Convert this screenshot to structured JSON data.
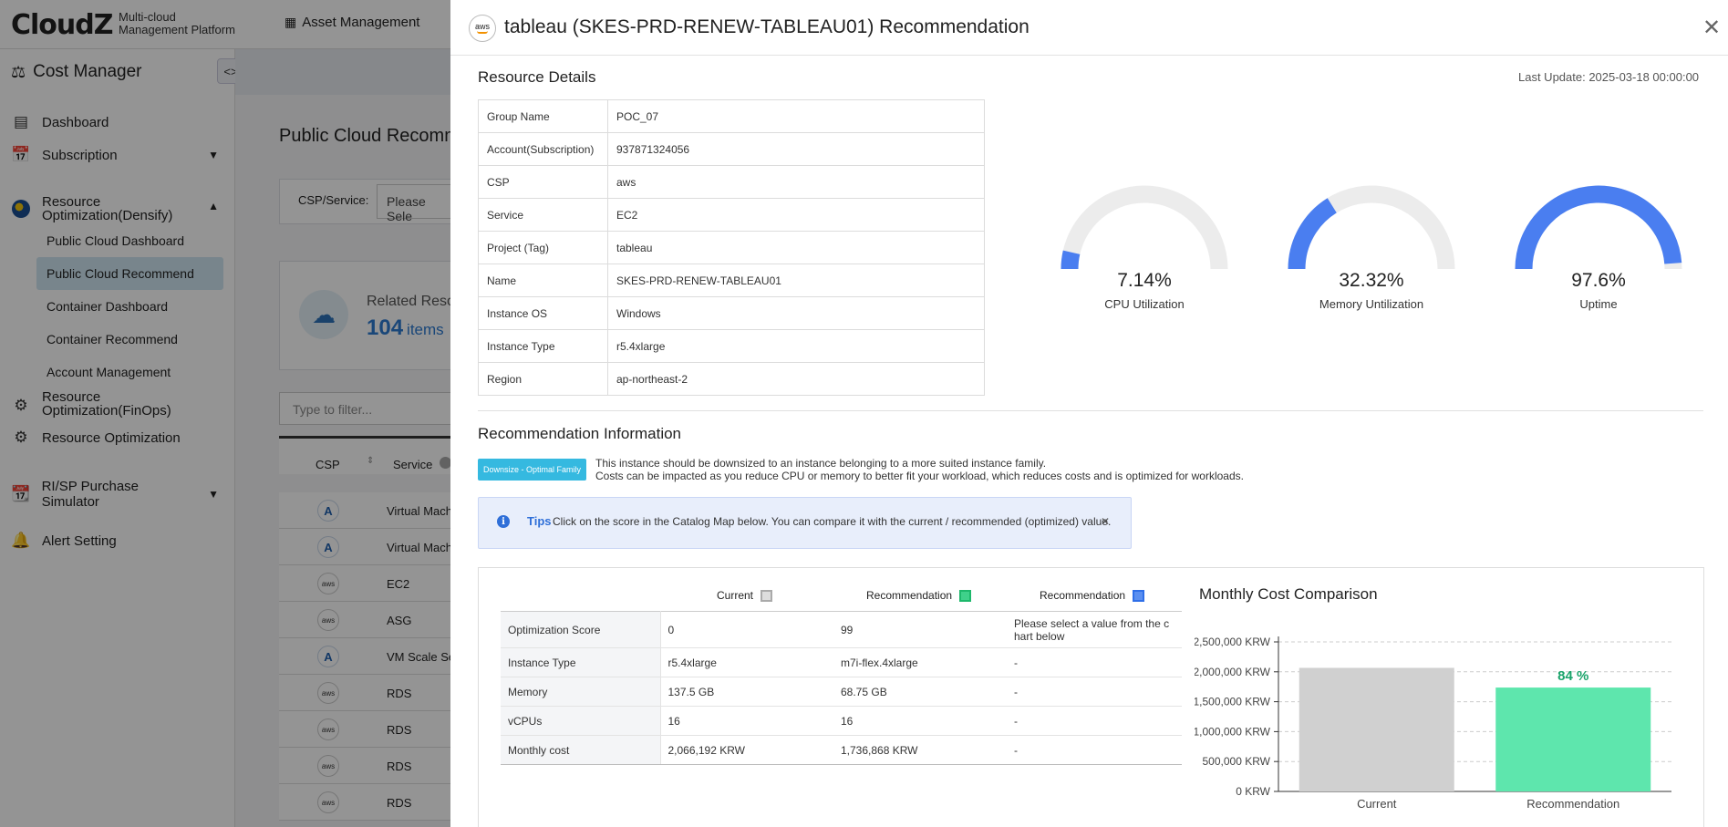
{
  "app": {
    "logo": "CloudZ",
    "logo_sub": "Multi-cloud\nManagement Platform",
    "top_nav": "Asset Management",
    "module_title": "Cost Manager",
    "toggle_icon": "code-brackets-icon"
  },
  "sidebar": {
    "items": [
      {
        "label": "Dashboard",
        "icon": "dashboard-grid-icon"
      },
      {
        "label": "Subscription",
        "icon": "calendar-icon"
      },
      {
        "label": "Resource Optimization(Densify)",
        "icon": "densify-logo-icon"
      },
      {
        "label": "Resource Optimization(FinOps)",
        "icon": "finops-gear-icon"
      },
      {
        "label": "Resource Optimization",
        "icon": "settings-gear-icon"
      },
      {
        "label": "RI/SP Purchase Simulator",
        "icon": "calendar-dollar-icon"
      },
      {
        "label": "Alert Setting",
        "icon": "bell-icon"
      }
    ],
    "sub_items": [
      {
        "label": "Public Cloud Dashboard",
        "active": false
      },
      {
        "label": "Public Cloud Recommend",
        "active": true
      },
      {
        "label": "Container Dashboard",
        "active": false
      },
      {
        "label": "Container Recommend",
        "active": false
      },
      {
        "label": "Account Management",
        "active": false
      }
    ]
  },
  "background_page": {
    "title": "Public Cloud Recomm",
    "csp_label": "CSP/Service:",
    "csp_select": "Please Sele",
    "related_label": "Related Reso",
    "related_count": "104",
    "related_unit": "items",
    "filter_placeholder": "Type to filter...",
    "columns": [
      "CSP",
      "Service"
    ],
    "rows": [
      {
        "csp": "azure",
        "service": "Virtual Machi"
      },
      {
        "csp": "azure",
        "service": "Virtual Machi"
      },
      {
        "csp": "aws",
        "service": "EC2"
      },
      {
        "csp": "aws",
        "service": "ASG"
      },
      {
        "csp": "azure",
        "service": "VM Scale Set"
      },
      {
        "csp": "aws",
        "service": "RDS"
      },
      {
        "csp": "aws",
        "service": "RDS"
      },
      {
        "csp": "aws",
        "service": "RDS"
      },
      {
        "csp": "aws",
        "service": "RDS"
      }
    ]
  },
  "modal": {
    "csp_badge": "aws",
    "title": "tableau (SKES-PRD-RENEW-TABLEAU01) Recommendation",
    "resource_details_title": "Resource Details",
    "last_update": "Last Update: 2025-03-18 00:00:00",
    "details": [
      {
        "key": "Group Name",
        "value": "POC_07"
      },
      {
        "key": "Account(Subscription)",
        "value": "937871324056"
      },
      {
        "key": "CSP",
        "value": "aws"
      },
      {
        "key": "Service",
        "value": "EC2"
      },
      {
        "key": "Project (Tag)",
        "value": "tableau"
      },
      {
        "key": "Name",
        "value": "SKES-PRD-RENEW-TABLEAU01"
      },
      {
        "key": "Instance OS",
        "value": "Windows"
      },
      {
        "key": "Instance Type",
        "value": "r5.4xlarge"
      },
      {
        "key": "Region",
        "value": "ap-northeast-2"
      }
    ],
    "gauges": [
      {
        "label": "CPU Utilization",
        "value_text": "7.14%",
        "fraction": 0.0714
      },
      {
        "label": "Memory Untilization",
        "value_text": "32.32%",
        "fraction": 0.3232
      },
      {
        "label": "Uptime",
        "value_text": "97.6%",
        "fraction": 0.976
      }
    ],
    "gauge_colors": {
      "fill": "#4a7ef0",
      "track": "#ececec"
    },
    "recommendation_title": "Recommendation Information",
    "recommendation_badge": "Downsize - Optimal Family",
    "recommendation_text_1": "This instance should be downsized to an instance belonging to a more suited instance family.",
    "recommendation_text_2": "Costs can be impacted as you reduce CPU or memory to better fit your workload, which reduces costs and is optimized for workloads.",
    "tips_label": "Tips",
    "tips_text": "Click on the score in the Catalog Map below. You can compare it with the current / recommended (optimized) value.",
    "compare": {
      "headers": [
        {
          "label": "Current",
          "color": "#bdbdbd"
        },
        {
          "label": "Recommendation",
          "color": "#1db86b"
        },
        {
          "label": "Recommendation",
          "color": "#2f6fe8"
        }
      ],
      "rows": [
        {
          "key": "Optimization Score",
          "current": "0",
          "rec": "99",
          "rec2": "Please select a value from the c\nhart below"
        },
        {
          "key": "Instance Type",
          "current": "r5.4xlarge",
          "rec": "m7i-flex.4xlarge",
          "rec2": "-"
        },
        {
          "key": "Memory",
          "current": "137.5 GB",
          "rec": "68.75 GB",
          "rec2": "-"
        },
        {
          "key": "vCPUs",
          "current": "16",
          "rec": "16",
          "rec2": "-"
        },
        {
          "key": "Monthly cost",
          "current": "2,066,192 KRW",
          "rec": "1,736,868 KRW",
          "rec2": "-"
        }
      ]
    }
  },
  "chart_data": {
    "type": "bar",
    "title": "Monthly Cost Comparison",
    "categories": [
      "Current",
      "Recommendation"
    ],
    "values": [
      2066192,
      1736868
    ],
    "bar_colors": [
      "#d0d0d0",
      "#5ee6ad"
    ],
    "bar_labels": [
      "",
      "84 %"
    ],
    "bar_label_color": "#1aa36a",
    "ylim": [
      0,
      2500000
    ],
    "yticks": [
      "0 KRW",
      "500,000 KRW",
      "1,000,000 KRW",
      "1,500,000 KRW",
      "2,000,000 KRW",
      "2,500,000 KRW"
    ],
    "ytick_values": [
      0,
      500000,
      1000000,
      1500000,
      2000000,
      2500000
    ],
    "grid": true
  }
}
